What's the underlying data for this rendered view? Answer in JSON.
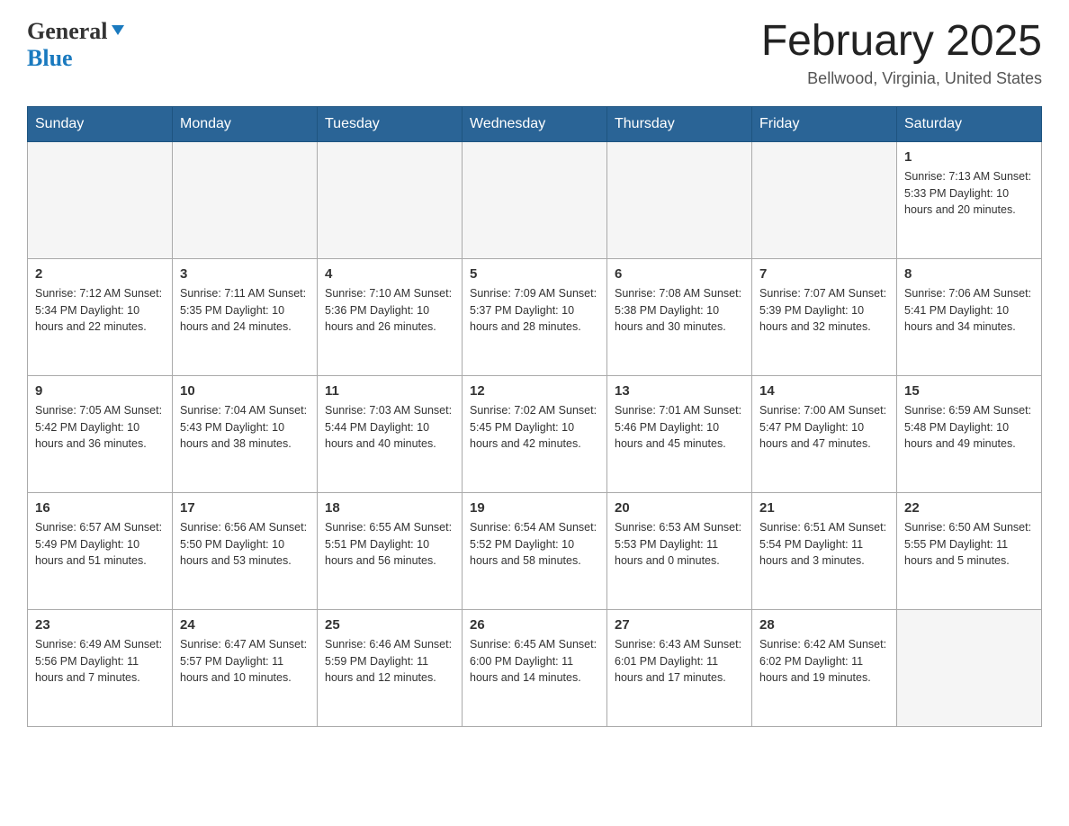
{
  "header": {
    "logo": {
      "general_text": "General",
      "blue_text": "Blue"
    },
    "title": "February 2025",
    "location": "Bellwood, Virginia, United States"
  },
  "weekdays": [
    "Sunday",
    "Monday",
    "Tuesday",
    "Wednesday",
    "Thursday",
    "Friday",
    "Saturday"
  ],
  "weeks": [
    [
      {
        "day": "",
        "info": ""
      },
      {
        "day": "",
        "info": ""
      },
      {
        "day": "",
        "info": ""
      },
      {
        "day": "",
        "info": ""
      },
      {
        "day": "",
        "info": ""
      },
      {
        "day": "",
        "info": ""
      },
      {
        "day": "1",
        "info": "Sunrise: 7:13 AM\nSunset: 5:33 PM\nDaylight: 10 hours\nand 20 minutes."
      }
    ],
    [
      {
        "day": "2",
        "info": "Sunrise: 7:12 AM\nSunset: 5:34 PM\nDaylight: 10 hours\nand 22 minutes."
      },
      {
        "day": "3",
        "info": "Sunrise: 7:11 AM\nSunset: 5:35 PM\nDaylight: 10 hours\nand 24 minutes."
      },
      {
        "day": "4",
        "info": "Sunrise: 7:10 AM\nSunset: 5:36 PM\nDaylight: 10 hours\nand 26 minutes."
      },
      {
        "day": "5",
        "info": "Sunrise: 7:09 AM\nSunset: 5:37 PM\nDaylight: 10 hours\nand 28 minutes."
      },
      {
        "day": "6",
        "info": "Sunrise: 7:08 AM\nSunset: 5:38 PM\nDaylight: 10 hours\nand 30 minutes."
      },
      {
        "day": "7",
        "info": "Sunrise: 7:07 AM\nSunset: 5:39 PM\nDaylight: 10 hours\nand 32 minutes."
      },
      {
        "day": "8",
        "info": "Sunrise: 7:06 AM\nSunset: 5:41 PM\nDaylight: 10 hours\nand 34 minutes."
      }
    ],
    [
      {
        "day": "9",
        "info": "Sunrise: 7:05 AM\nSunset: 5:42 PM\nDaylight: 10 hours\nand 36 minutes."
      },
      {
        "day": "10",
        "info": "Sunrise: 7:04 AM\nSunset: 5:43 PM\nDaylight: 10 hours\nand 38 minutes."
      },
      {
        "day": "11",
        "info": "Sunrise: 7:03 AM\nSunset: 5:44 PM\nDaylight: 10 hours\nand 40 minutes."
      },
      {
        "day": "12",
        "info": "Sunrise: 7:02 AM\nSunset: 5:45 PM\nDaylight: 10 hours\nand 42 minutes."
      },
      {
        "day": "13",
        "info": "Sunrise: 7:01 AM\nSunset: 5:46 PM\nDaylight: 10 hours\nand 45 minutes."
      },
      {
        "day": "14",
        "info": "Sunrise: 7:00 AM\nSunset: 5:47 PM\nDaylight: 10 hours\nand 47 minutes."
      },
      {
        "day": "15",
        "info": "Sunrise: 6:59 AM\nSunset: 5:48 PM\nDaylight: 10 hours\nand 49 minutes."
      }
    ],
    [
      {
        "day": "16",
        "info": "Sunrise: 6:57 AM\nSunset: 5:49 PM\nDaylight: 10 hours\nand 51 minutes."
      },
      {
        "day": "17",
        "info": "Sunrise: 6:56 AM\nSunset: 5:50 PM\nDaylight: 10 hours\nand 53 minutes."
      },
      {
        "day": "18",
        "info": "Sunrise: 6:55 AM\nSunset: 5:51 PM\nDaylight: 10 hours\nand 56 minutes."
      },
      {
        "day": "19",
        "info": "Sunrise: 6:54 AM\nSunset: 5:52 PM\nDaylight: 10 hours\nand 58 minutes."
      },
      {
        "day": "20",
        "info": "Sunrise: 6:53 AM\nSunset: 5:53 PM\nDaylight: 11 hours\nand 0 minutes."
      },
      {
        "day": "21",
        "info": "Sunrise: 6:51 AM\nSunset: 5:54 PM\nDaylight: 11 hours\nand 3 minutes."
      },
      {
        "day": "22",
        "info": "Sunrise: 6:50 AM\nSunset: 5:55 PM\nDaylight: 11 hours\nand 5 minutes."
      }
    ],
    [
      {
        "day": "23",
        "info": "Sunrise: 6:49 AM\nSunset: 5:56 PM\nDaylight: 11 hours\nand 7 minutes."
      },
      {
        "day": "24",
        "info": "Sunrise: 6:47 AM\nSunset: 5:57 PM\nDaylight: 11 hours\nand 10 minutes."
      },
      {
        "day": "25",
        "info": "Sunrise: 6:46 AM\nSunset: 5:59 PM\nDaylight: 11 hours\nand 12 minutes."
      },
      {
        "day": "26",
        "info": "Sunrise: 6:45 AM\nSunset: 6:00 PM\nDaylight: 11 hours\nand 14 minutes."
      },
      {
        "day": "27",
        "info": "Sunrise: 6:43 AM\nSunset: 6:01 PM\nDaylight: 11 hours\nand 17 minutes."
      },
      {
        "day": "28",
        "info": "Sunrise: 6:42 AM\nSunset: 6:02 PM\nDaylight: 11 hours\nand 19 minutes."
      },
      {
        "day": "",
        "info": ""
      }
    ]
  ]
}
